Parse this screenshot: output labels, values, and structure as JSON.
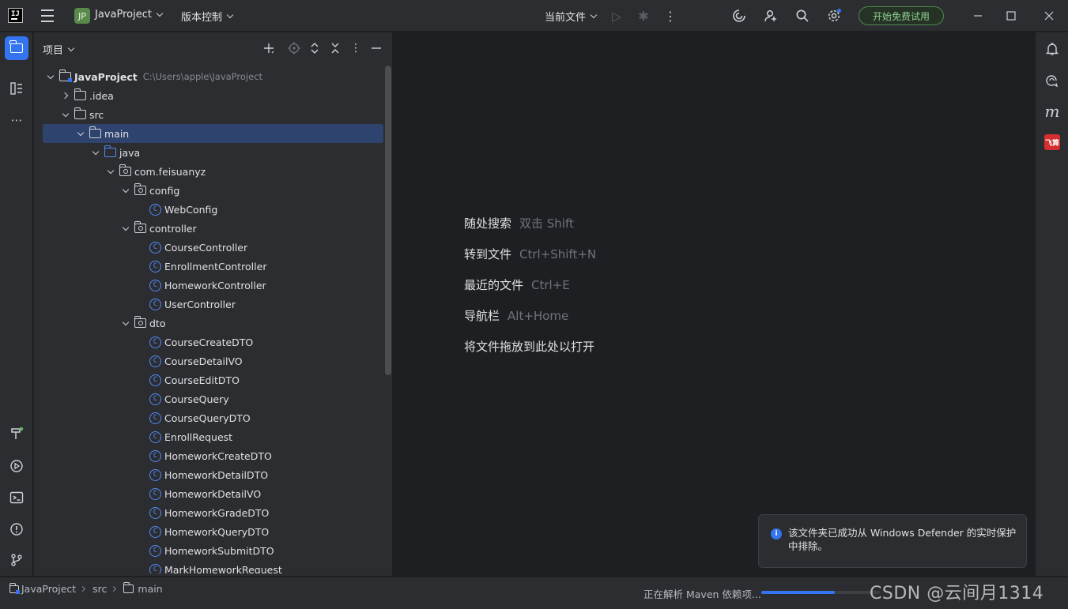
{
  "titlebar": {
    "logo_text": "IJ",
    "project_badge": "JP",
    "project_name": "JavaProject",
    "vcs_label": "版本控制",
    "run_config": "当前文件",
    "trial_button": "开始免费试用"
  },
  "project_panel": {
    "title": "项目",
    "tree": [
      {
        "label": "JavaProject",
        "hint": "C:\\Users\\apple\\JavaProject",
        "depth": 0,
        "arrow": "down",
        "icon": "module-folder",
        "bold": true
      },
      {
        "label": ".idea",
        "depth": 1,
        "arrow": "right",
        "icon": "folder"
      },
      {
        "label": "src",
        "depth": 1,
        "arrow": "down",
        "icon": "folder"
      },
      {
        "label": "main",
        "depth": 2,
        "arrow": "down",
        "icon": "folder",
        "selected": true
      },
      {
        "label": "java",
        "depth": 3,
        "arrow": "down",
        "icon": "source-folder"
      },
      {
        "label": "com.feisuanyz",
        "depth": 4,
        "arrow": "down",
        "icon": "package"
      },
      {
        "label": "config",
        "depth": 5,
        "arrow": "down",
        "icon": "package"
      },
      {
        "label": "WebConfig",
        "depth": 6,
        "arrow": "none",
        "icon": "class"
      },
      {
        "label": "controller",
        "depth": 5,
        "arrow": "down",
        "icon": "package"
      },
      {
        "label": "CourseController",
        "depth": 6,
        "arrow": "none",
        "icon": "class"
      },
      {
        "label": "EnrollmentController",
        "depth": 6,
        "arrow": "none",
        "icon": "class"
      },
      {
        "label": "HomeworkController",
        "depth": 6,
        "arrow": "none",
        "icon": "class"
      },
      {
        "label": "UserController",
        "depth": 6,
        "arrow": "none",
        "icon": "class"
      },
      {
        "label": "dto",
        "depth": 5,
        "arrow": "down",
        "icon": "package"
      },
      {
        "label": "CourseCreateDTO",
        "depth": 6,
        "arrow": "none",
        "icon": "class"
      },
      {
        "label": "CourseDetailVO",
        "depth": 6,
        "arrow": "none",
        "icon": "class"
      },
      {
        "label": "CourseEditDTO",
        "depth": 6,
        "arrow": "none",
        "icon": "class"
      },
      {
        "label": "CourseQuery",
        "depth": 6,
        "arrow": "none",
        "icon": "class"
      },
      {
        "label": "CourseQueryDTO",
        "depth": 6,
        "arrow": "none",
        "icon": "class"
      },
      {
        "label": "EnrollRequest",
        "depth": 6,
        "arrow": "none",
        "icon": "class"
      },
      {
        "label": "HomeworkCreateDTO",
        "depth": 6,
        "arrow": "none",
        "icon": "class"
      },
      {
        "label": "HomeworkDetailDTO",
        "depth": 6,
        "arrow": "none",
        "icon": "class"
      },
      {
        "label": "HomeworkDetailVO",
        "depth": 6,
        "arrow": "none",
        "icon": "class"
      },
      {
        "label": "HomeworkGradeDTO",
        "depth": 6,
        "arrow": "none",
        "icon": "class"
      },
      {
        "label": "HomeworkQueryDTO",
        "depth": 6,
        "arrow": "none",
        "icon": "class"
      },
      {
        "label": "HomeworkSubmitDTO",
        "depth": 6,
        "arrow": "none",
        "icon": "class"
      },
      {
        "label": "MarkHomeworkRequest",
        "depth": 6,
        "arrow": "none",
        "icon": "class"
      }
    ]
  },
  "editor": {
    "hints": [
      {
        "action": "随处搜索",
        "shortcut": "双击 Shift"
      },
      {
        "action": "转到文件",
        "shortcut": "Ctrl+Shift+N"
      },
      {
        "action": "最近的文件",
        "shortcut": "Ctrl+E"
      },
      {
        "action": "导航栏",
        "shortcut": "Alt+Home"
      },
      {
        "action": "将文件拖放到此处以打开",
        "shortcut": ""
      }
    ]
  },
  "right_toolbar": {
    "feisuan_label": "飞算",
    "m_label": "m"
  },
  "notification": {
    "text": "该文件夹已成功从 Windows Defender 的实时保护中排除。"
  },
  "statusbar": {
    "breadcrumb": [
      "JavaProject",
      "src",
      "main"
    ],
    "status_text": "正在解析 Maven 依赖项...",
    "progress": 0.62,
    "watermark": "CSDN @云间月1314"
  },
  "colors": {
    "accent": "#3574f0",
    "selection": "#2e436e",
    "background": "#1e1f22",
    "panel": "#2b2d30",
    "trial_green": "#8ed18e"
  }
}
